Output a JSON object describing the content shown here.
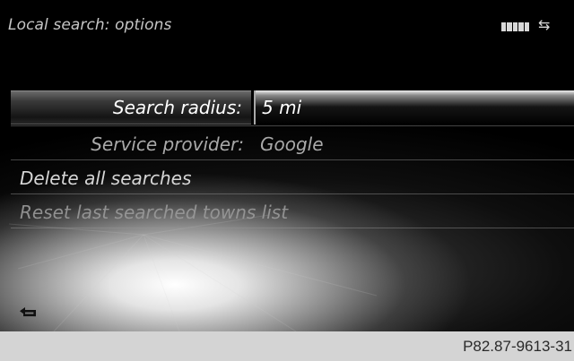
{
  "header": {
    "title": "Local search: options",
    "signal_icon": "signal-strength-icon",
    "connection_icon": "connection-arrows-icon",
    "connection_glyph": "⇆"
  },
  "menu": {
    "search_radius": {
      "label": "Search radius:",
      "value": "5 mi"
    },
    "service_provider": {
      "label": "Service provider:",
      "value": "Google"
    },
    "delete_all": {
      "label": "Delete all searches"
    },
    "reset_towns": {
      "label": "Reset last searched towns list"
    }
  },
  "back": {
    "icon": "back-arrow-icon"
  },
  "footer": {
    "code": "P82.87-9613-31"
  },
  "colors": {
    "background": "#000000",
    "text": "#d6d6d6",
    "selected_text": "#ffffff",
    "footer": "#d4d4d4"
  }
}
